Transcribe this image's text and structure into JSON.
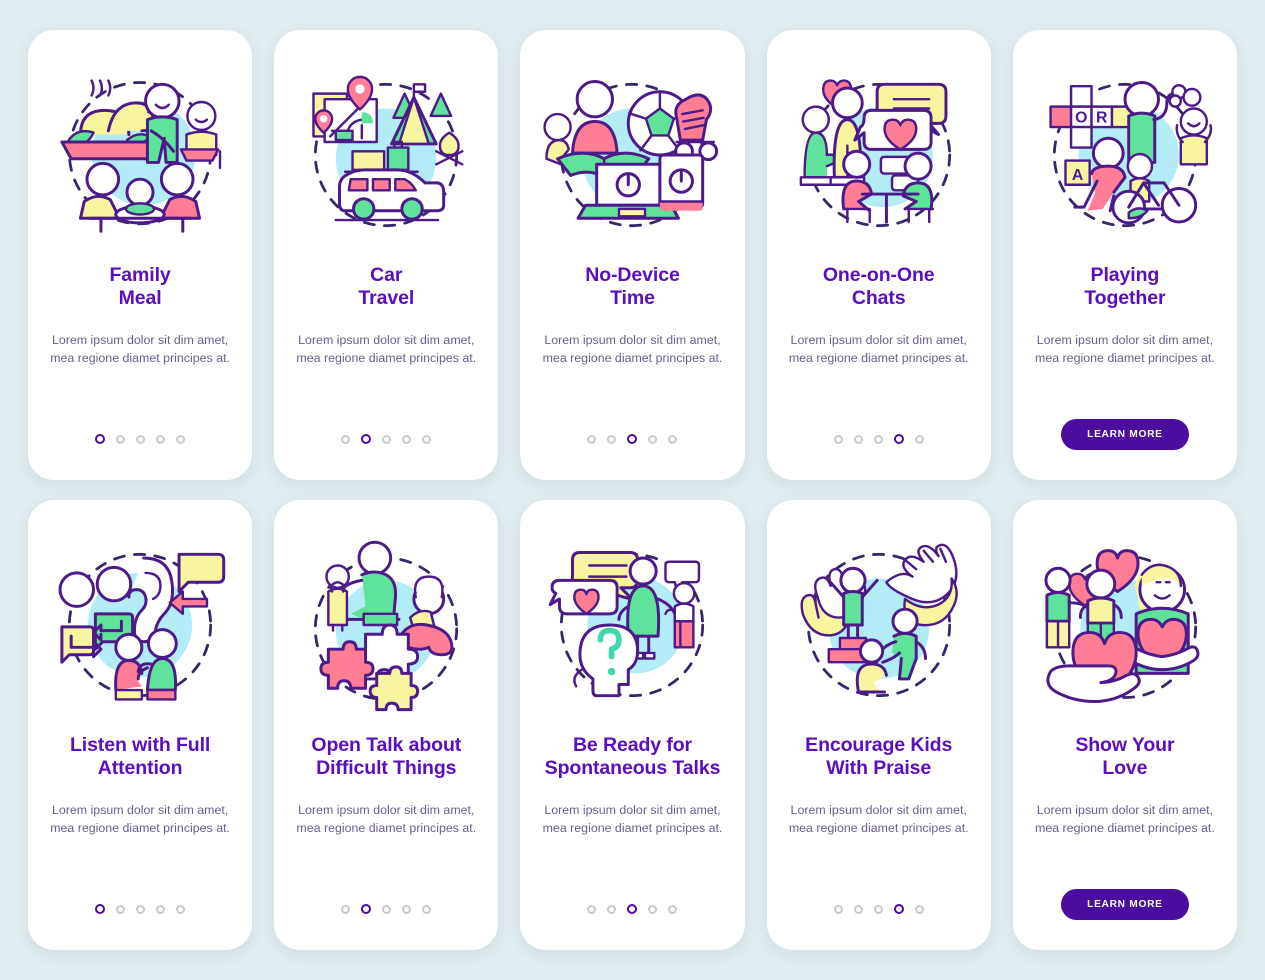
{
  "page": {
    "background_color": "#e2eef1",
    "card_color": "#ffffff",
    "title_color": "#5b0ebe",
    "body_color": "#6b5c92",
    "accent_color": "#4c0d9e",
    "dot_inactive_color": "#c9c9d2",
    "blob_color": "#b3ecf7"
  },
  "shared": {
    "body_text": "Lorem ipsum dolor sit dim amet, mea regione diamet principes at.",
    "learn_more_label": "LEARN MORE",
    "dot_count": 5
  },
  "cards": [
    {
      "id": "family-meal",
      "title": "Family\nMeal",
      "body": "Lorem ipsum dolor sit dim amet, mea regione diamet principes at.",
      "footer_type": "dots",
      "active_dot": 1,
      "icon": "family-meal-illustration"
    },
    {
      "id": "car-travel",
      "title": "Car\nTravel",
      "body": "Lorem ipsum dolor sit dim amet, mea regione diamet principes at.",
      "footer_type": "dots",
      "active_dot": 2,
      "icon": "car-travel-illustration"
    },
    {
      "id": "no-device-time",
      "title": "No-Device\nTime",
      "body": "Lorem ipsum dolor sit dim amet, mea regione diamet principes at.",
      "footer_type": "dots",
      "active_dot": 3,
      "icon": "no-device-time-illustration"
    },
    {
      "id": "one-on-one-chats",
      "title": "One-on-One\nChats",
      "body": "Lorem ipsum dolor sit dim amet, mea regione diamet principes at.",
      "footer_type": "dots",
      "active_dot": 4,
      "icon": "one-on-one-chats-illustration"
    },
    {
      "id": "playing-together",
      "title": "Playing\nTogether",
      "body": "Lorem ipsum dolor sit dim amet, mea regione diamet principes at.",
      "footer_type": "button",
      "button_label": "LEARN MORE",
      "icon": "playing-together-illustration"
    },
    {
      "id": "listen-with-full-attention",
      "title": "Listen with Full\nAttention",
      "body": "Lorem ipsum dolor sit dim amet, mea regione diamet principes at.",
      "footer_type": "dots",
      "active_dot": 1,
      "icon": "listening-ear-illustration"
    },
    {
      "id": "open-talk-about-difficult-things",
      "title": "Open Talk about\nDifficult Things",
      "body": "Lorem ipsum dolor sit dim amet, mea regione diamet principes at.",
      "footer_type": "dots",
      "active_dot": 2,
      "icon": "puzzle-talk-illustration"
    },
    {
      "id": "be-ready-for-spontaneous-talks",
      "title": "Be Ready for\nSpontaneous Talks",
      "body": "Lorem ipsum dolor sit dim amet, mea regione diamet principes at.",
      "footer_type": "dots",
      "active_dot": 3,
      "icon": "question-head-illustration"
    },
    {
      "id": "encourage-kids-with-praise",
      "title": "Encourage Kids\nWith Praise",
      "body": "Lorem ipsum dolor sit dim amet, mea regione diamet principes at.",
      "footer_type": "dots",
      "active_dot": 4,
      "icon": "applause-podium-illustration"
    },
    {
      "id": "show-your-love",
      "title": "Show Your\nLove",
      "body": "Lorem ipsum dolor sit dim amet, mea regione diamet principes at.",
      "footer_type": "button",
      "button_label": "LEARN MORE",
      "icon": "heart-hand-illustration"
    }
  ]
}
